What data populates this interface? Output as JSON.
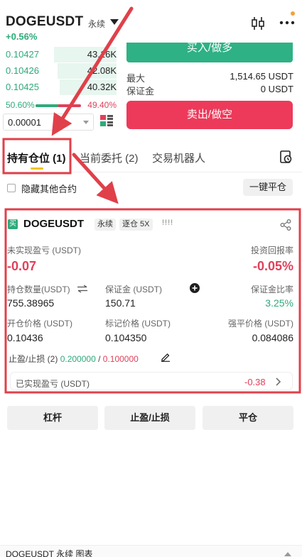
{
  "header": {
    "symbol": "DOGEUSDT",
    "contract_type": "永续",
    "change": "+0.56%"
  },
  "order_book": {
    "rows": [
      {
        "price": "0.10427",
        "qty": "43.16K",
        "depth": 0.55
      },
      {
        "price": "0.10426",
        "qty": "42.08K",
        "depth": 0.52
      },
      {
        "price": "0.10425",
        "qty": "40.32K",
        "depth": 0.5
      }
    ],
    "buy_ratio": "50.60%",
    "sell_ratio": "49.40%",
    "buy_fraction": 0.506,
    "precision": "0.00001"
  },
  "trade": {
    "buy_label": "买入/做多",
    "max_label": "最大",
    "max_value": "1,514.65 USDT",
    "margin_label": "保证金",
    "margin_value": "0 USDT",
    "sell_label": "卖出/做空"
  },
  "tabs": [
    {
      "label": "持有仓位 (1)"
    },
    {
      "label": "当前委托 (2)"
    },
    {
      "label": "交易机器人"
    }
  ],
  "filter": {
    "hide_label": "隐藏其他合约",
    "close_all_label": "一键平仓"
  },
  "position": {
    "badge": "买",
    "symbol": "DOGEUSDT",
    "contract_type": "永续",
    "margin_mode": "逐仓 5X",
    "stripes": "!!!!",
    "upnl_label": "未实现盈亏 (USDT)",
    "upnl_value": "-0.07",
    "roi_label": "投资回报率",
    "roi_value": "-0.05%",
    "size_label": "持仓数量(USDT)",
    "size_value": "755.38965",
    "margin_label": "保证金 (USDT)",
    "margin_value": "150.71",
    "margin_ratio_label": "保证金比率",
    "margin_ratio_value": "3.25%",
    "entry_label": "开仓价格 (USDT)",
    "entry_value": "0.10436",
    "mark_label": "标记价格 (USDT)",
    "mark_value": "0.104350",
    "liq_label": "强平价格 (USDT)",
    "liq_value": "0.084086",
    "tpsl_label": "止盈/止损 (2)",
    "tp_value": "0.200000",
    "sl_sep": "/",
    "sl_value": "0.100000",
    "realized_label": "已实现盈亏 (USDT)",
    "realized_value": "-0.38"
  },
  "actions": {
    "leverage": "杠杆",
    "tpsl": "止盈/止损",
    "close": "平仓"
  },
  "bottom": {
    "label": "DOGEUSDT 永续 图表"
  },
  "colors": {
    "green": "#2eaa7a",
    "red": "#e0405a",
    "annotation": "#e0404a",
    "tab_accent": "#f0c419"
  }
}
